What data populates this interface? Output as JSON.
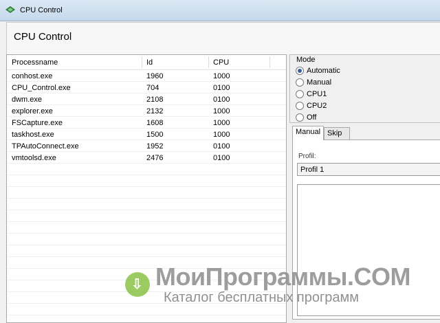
{
  "window": {
    "title": "CPU Control"
  },
  "header": {
    "title": "CPU Control"
  },
  "process_list": {
    "columns": [
      "Processname",
      "Id",
      "CPU"
    ],
    "rows": [
      [
        "conhost.exe",
        "1960",
        "1000"
      ],
      [
        "CPU_Control.exe",
        "704",
        "0100"
      ],
      [
        "dwm.exe",
        "2108",
        "0100"
      ],
      [
        "explorer.exe",
        "2132",
        "1000"
      ],
      [
        "FSCapture.exe",
        "1608",
        "1000"
      ],
      [
        "taskhost.exe",
        "1500",
        "1000"
      ],
      [
        "TPAutoConnect.exe",
        "1952",
        "0100"
      ],
      [
        "vmtoolsd.exe",
        "2476",
        "0100"
      ]
    ]
  },
  "mode": {
    "label": "Mode",
    "options": [
      "Automatic",
      "Manual",
      "CPU1",
      "CPU2",
      "Off"
    ],
    "selected": "Automatic"
  },
  "tabs": [
    "Manual",
    "Skip"
  ],
  "active_tab": "Manual",
  "profil": {
    "label": "Profil:",
    "value": "Profil 1"
  },
  "watermark": {
    "title": "МоиПрограммы.COM",
    "subtitle": "Каталог бесплатных программ"
  }
}
